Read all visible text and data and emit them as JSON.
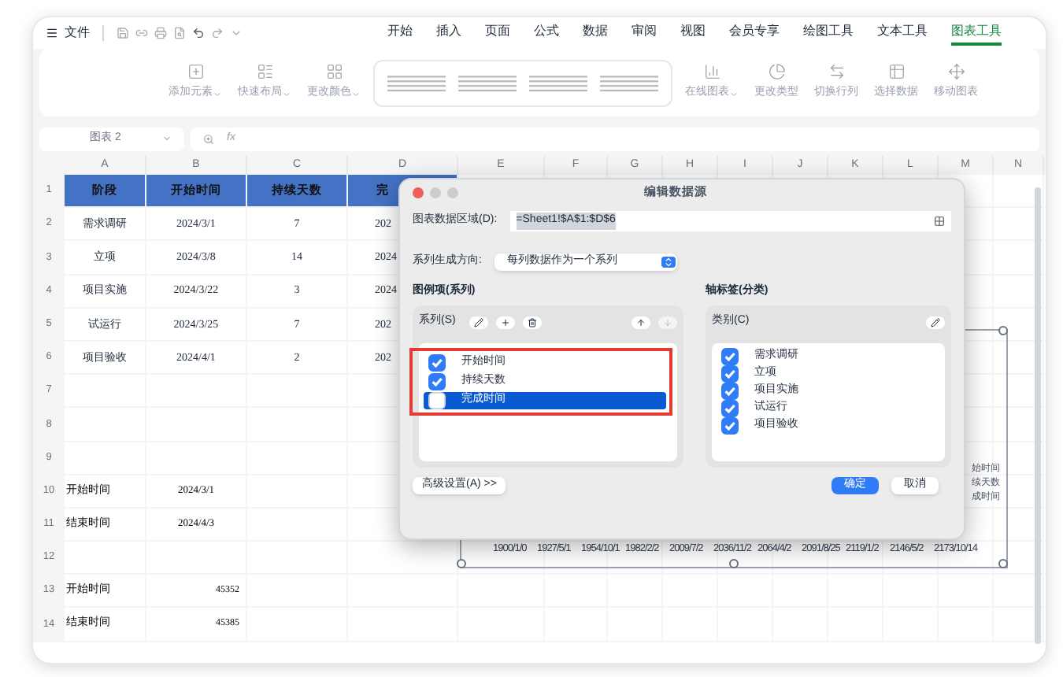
{
  "menu": {
    "file": "文件",
    "tabs": [
      {
        "label": "开始",
        "selected": false
      },
      {
        "label": "插入",
        "selected": false
      },
      {
        "label": "页面",
        "selected": false
      },
      {
        "label": "公式",
        "selected": false
      },
      {
        "label": "数据",
        "selected": false
      },
      {
        "label": "审阅",
        "selected": false
      },
      {
        "label": "视图",
        "selected": false
      },
      {
        "label": "会员专享",
        "selected": false
      },
      {
        "label": "绘图工具",
        "selected": false
      },
      {
        "label": "文本工具",
        "selected": false
      },
      {
        "label": "图表工具",
        "selected": true
      }
    ]
  },
  "ribbon": [
    {
      "kind": "add",
      "label": "添加元素",
      "dropdown": true
    },
    {
      "kind": "layout",
      "label": "快速布局",
      "dropdown": true
    },
    {
      "kind": "color",
      "label": "更改颜色",
      "dropdown": true
    },
    {
      "kind": "gallery"
    },
    {
      "kind": "online",
      "label": "在线图表",
      "dropdown": true
    },
    {
      "kind": "type",
      "label": "更改类型",
      "dropdown": false
    },
    {
      "kind": "switch",
      "label": "切换行列",
      "dropdown": false
    },
    {
      "kind": "data",
      "label": "选择数据",
      "dropdown": false
    },
    {
      "kind": "move",
      "label": "移动图表",
      "dropdown": false
    }
  ],
  "name_box": "图表 2",
  "formula_prefix": "fx",
  "columns": [
    "A",
    "B",
    "C",
    "D",
    "E",
    "F",
    "G",
    "H",
    "I",
    "J",
    "K",
    "L",
    "M",
    "N"
  ],
  "rows": [
    {
      "number": "1",
      "kind": "header",
      "cells": [
        "阶段",
        "开始时间",
        "持续天数",
        "完"
      ]
    },
    {
      "number": "2",
      "kind": "data",
      "cells": [
        "需求调研",
        "2024/3/1",
        "7",
        "202"
      ]
    },
    {
      "number": "3",
      "kind": "data",
      "cells": [
        "立项",
        "2024/3/8",
        "14",
        "2024"
      ]
    },
    {
      "number": "4",
      "kind": "data",
      "cells": [
        "项目实施",
        "2024/3/22",
        "3",
        "2024"
      ]
    },
    {
      "number": "5",
      "kind": "data",
      "cells": [
        "试运行",
        "2024/3/25",
        "7",
        "202"
      ]
    },
    {
      "number": "6",
      "kind": "data",
      "cells": [
        "项目验收",
        "2024/4/1",
        "2",
        "202"
      ]
    },
    {
      "number": "7",
      "kind": "empty",
      "cells": []
    },
    {
      "number": "8",
      "kind": "empty",
      "cells": []
    },
    {
      "number": "9",
      "kind": "empty",
      "cells": []
    },
    {
      "number": "10",
      "kind": "note",
      "cells": [
        "开始时间",
        "2024/3/1"
      ]
    },
    {
      "number": "11",
      "kind": "note",
      "cells": [
        "结束时间",
        "2024/4/3"
      ]
    },
    {
      "number": "12",
      "kind": "empty",
      "cells": []
    },
    {
      "number": "13",
      "kind": "number",
      "cells": [
        "开始时间",
        "45352"
      ]
    },
    {
      "number": "14",
      "kind": "number",
      "cells": [
        "结束时间",
        "45385"
      ]
    }
  ],
  "chart": {
    "legend": [
      "始时间",
      "续天数",
      "成时间"
    ],
    "axis_labels": [
      "1900/1/0",
      "1927/5/1",
      "1954/10/1",
      "1982/2/2",
      "2009/7/2",
      "2036/11/2",
      "2064/4/2",
      "2091/8/25",
      "2119/1/2",
      "2146/5/2",
      "2173/10/14"
    ]
  },
  "dialog": {
    "title": "编辑数据源",
    "range_label": "图表数据区域(D):",
    "range_value": "=Sheet1!$A$1:$D$6",
    "direction_label": "系列生成方向:",
    "direction_value": "每列数据作为一个系列",
    "series_title": "图例项(系列)",
    "series_label": "系列(S)",
    "series": [
      {
        "label": "开始时间",
        "checked": true,
        "selected": false
      },
      {
        "label": "持续天数",
        "checked": true,
        "selected": false
      },
      {
        "label": "完成时间",
        "checked": false,
        "selected": true
      }
    ],
    "category_title": "轴标签(分类)",
    "category_label": "类别(C)",
    "categories": [
      {
        "label": "需求调研",
        "checked": true
      },
      {
        "label": "立项",
        "checked": true
      },
      {
        "label": "项目实施",
        "checked": true
      },
      {
        "label": "试运行",
        "checked": true
      },
      {
        "label": "项目验收",
        "checked": true
      }
    ],
    "advanced_button": "高级设置(A) >>",
    "ok_button": "确定",
    "cancel_button": "取消"
  }
}
